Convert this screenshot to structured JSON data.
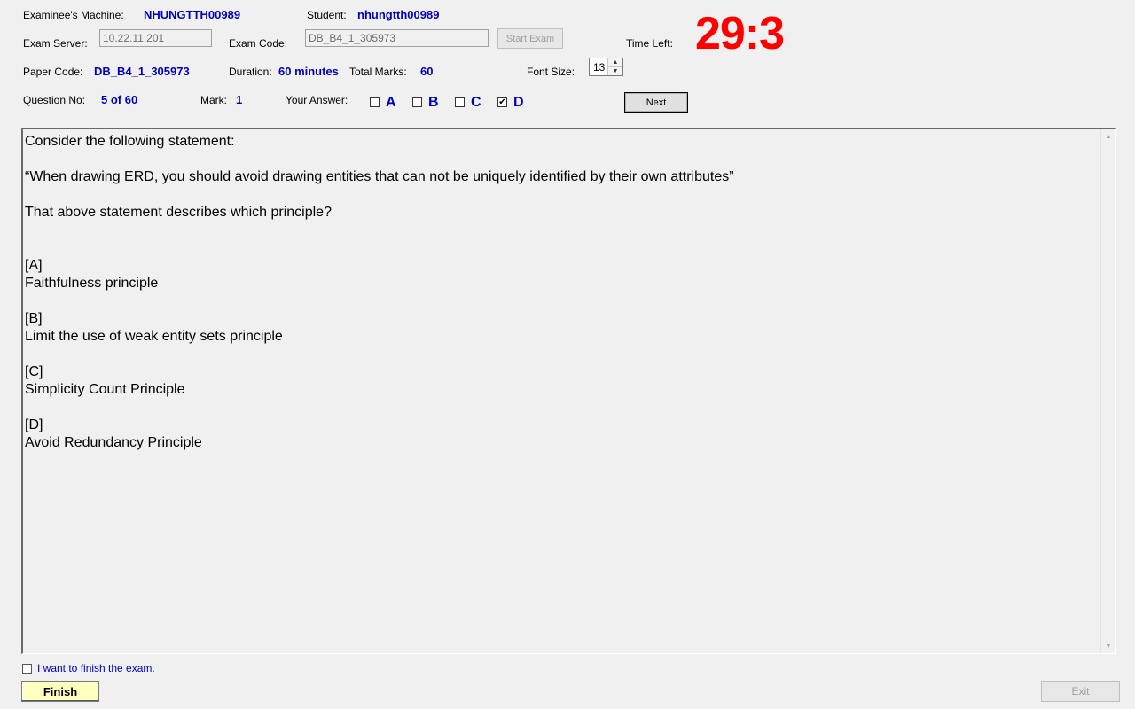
{
  "header": {
    "examinee_machine_label": "Examinee's Machine:",
    "examinee_machine_value": "NHUNGTTH00989",
    "student_label": "Student:",
    "student_value": "nhungtth00989",
    "exam_server_label": "Exam Server:",
    "exam_server_value": "10.22.11.201",
    "exam_code_label": "Exam Code:",
    "exam_code_value": "DB_B4_1_305973",
    "start_exam_label": "Start Exam",
    "time_left_label": "Time Left:",
    "time_left_value": "29:3",
    "paper_code_label": "Paper Code:",
    "paper_code_value": "DB_B4_1_305973",
    "duration_label": "Duration:",
    "duration_value": "60 minutes",
    "total_marks_label": "Total Marks:",
    "total_marks_value": "60",
    "font_size_label": "Font Size:",
    "font_size_value": "13"
  },
  "question_bar": {
    "question_no_label": "Question No:",
    "question_no_value": "5 of 60",
    "mark_label": "Mark:",
    "mark_value": "1",
    "your_answer_label": "Your Answer:",
    "options": [
      {
        "letter": "A",
        "checked": false
      },
      {
        "letter": "B",
        "checked": false
      },
      {
        "letter": "C",
        "checked": false
      },
      {
        "letter": "D",
        "checked": true
      }
    ],
    "next_label": "Next"
  },
  "question": {
    "intro": "Consider the following statement:",
    "statement": "“When drawing ERD, you should avoid drawing entities that can not be uniquely identified by their own attributes”",
    "prompt": "That above statement describes which principle?",
    "answers": [
      {
        "tag": "[A]",
        "text": "Faithfulness principle"
      },
      {
        "tag": "[B]",
        "text": "Limit the use of weak entity sets principle"
      },
      {
        "tag": "[C]",
        "text": "Simplicity Count Principle"
      },
      {
        "tag": "[D]",
        "text": "Avoid Redundancy Principle"
      }
    ]
  },
  "footer": {
    "finish_checkbox_label": "I want to finish the exam.",
    "finish_checked": false,
    "finish_label": "Finish",
    "exit_label": "Exit"
  },
  "colors": {
    "timer": "#ff0000",
    "value_text": "#0000c0",
    "finish_button": "#ffffc0",
    "background": "#f0f0f0"
  },
  "icons": {
    "spinner_up": "triangle-up",
    "spinner_down": "triangle-down",
    "scroll_up": "triangle-up",
    "scroll_down": "triangle-down",
    "check": "check-mark"
  }
}
